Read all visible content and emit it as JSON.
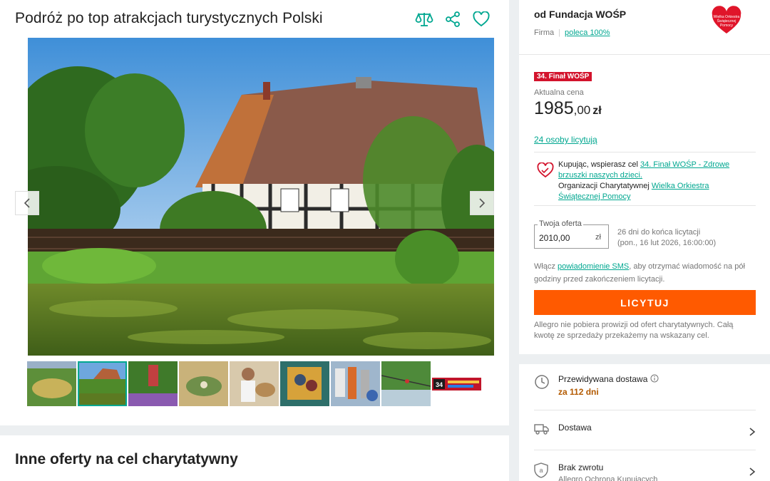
{
  "listing": {
    "title": "Podróż po top atrakcjach turystycznych Polski",
    "compare_icon": "scales-icon",
    "share_icon": "share-icon",
    "favorite_icon": "heart-outline-icon"
  },
  "gallery": {
    "thumbnail_count": 9,
    "last_thumb_text": "34"
  },
  "other_offers": {
    "title": "Inne oferty na cel charytatywny"
  },
  "seller": {
    "name": "od Fundacja WOŚP",
    "type": "Firma",
    "recommend": "poleca 100%",
    "logo_text": [
      "Wielka Orkiestra",
      "Świątecznej",
      "Pomocy"
    ]
  },
  "auction": {
    "badge": "34. Finał WOŚP",
    "price_label": "Aktualna cena",
    "price_int": "1985",
    "price_dec": ",00",
    "currency": "zł",
    "bidders": "24 osoby licytują"
  },
  "charity": {
    "line1": "Kupując, wspierasz cel ",
    "goal_link": "34. Finał WOŚP - Zdrowe brzuszki naszych dzieci.",
    "line2": "Organizacji Charytatywnej ",
    "org_link": "Wielka Orkiestra Świątecznej Pomocy"
  },
  "offer": {
    "legend": "Twoja oferta",
    "value": "2010,00",
    "currency": "zł",
    "time_left": "26 dni do końca licytacji",
    "end_date": "(pon., 16 lut 2026, 16:00:00)"
  },
  "sms": {
    "prefix": "Włącz ",
    "link": "powiadomienie SMS",
    "suffix": ", aby otrzymać wiadomość na pół godziny przed zakończeniem licytacji."
  },
  "bid_button": "LICYTUJ",
  "note": "Allegro nie pobiera prowizji od ofert charytatywnych. Całą kwotę ze sprzedaży przekażemy na wskazany cel.",
  "delivery": {
    "expected_label": "Przewidywana dostawa",
    "expected_value": "za 112 dni",
    "shipping_label": "Dostawa",
    "return_label": "Brak zwrotu",
    "return_sub": "Allegro Ochrona Kupujących"
  },
  "colors": {
    "accent": "#00a790",
    "cta": "#ff5a00",
    "badge": "#d3132c"
  }
}
